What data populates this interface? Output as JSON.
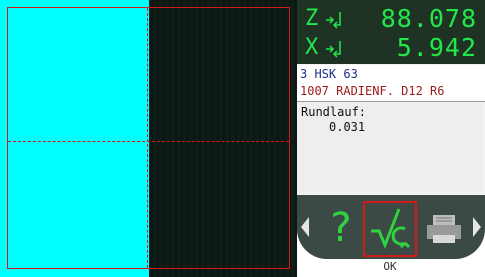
{
  "readout": {
    "z": {
      "axis": "Z",
      "value": "88.078"
    },
    "x": {
      "axis": "X",
      "value": "5.942"
    }
  },
  "tool": {
    "line1": "3  HSK 63",
    "line2": "1007 RADIENF. D12 R6"
  },
  "message": {
    "label": "Rundlauf:",
    "value": "0.031"
  },
  "buttons": {
    "ok_label": "OK"
  },
  "colors": {
    "accent_green": "#22e84a",
    "frame_red": "#d21a1a",
    "view_cyan": "#00ffff",
    "panel_dark": "#1e3324"
  }
}
